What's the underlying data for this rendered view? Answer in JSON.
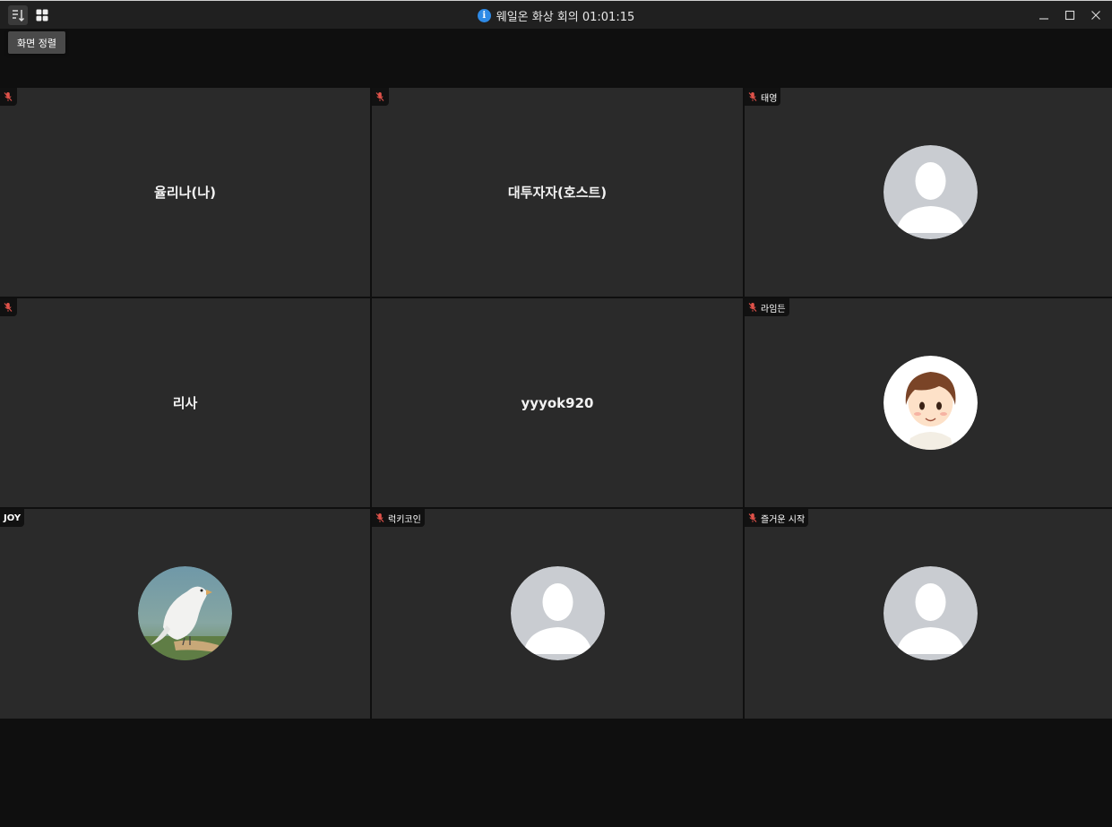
{
  "window": {
    "title": "웨일온 화상 회의 01:01:15",
    "toolbar": {
      "sort_icon": "sort-icon",
      "grid_icon": "grid-view-icon",
      "sort_tooltip": "화면 정렬"
    },
    "controls": [
      "minimize-icon",
      "maximize-icon",
      "close-icon"
    ]
  },
  "colors": {
    "background": "#0f0f0f",
    "tile": "#2a2a2a",
    "titlebar": "#202020",
    "muted_mic": "#e0524a",
    "info_badge": "#2e8ae6",
    "avatar_placeholder": "#c9ccd1"
  },
  "participants": [
    {
      "id": "p1",
      "tag": "",
      "muted": true,
      "display_name": "율리나(나)",
      "avatar": "none"
    },
    {
      "id": "p2",
      "tag": "",
      "muted": true,
      "display_name": "대투자자(호스트)",
      "avatar": "none"
    },
    {
      "id": "p3",
      "tag": "태영",
      "muted": true,
      "display_name": "",
      "avatar": "default-person-icon"
    },
    {
      "id": "p4",
      "tag": "",
      "muted": true,
      "display_name": "리사",
      "avatar": "none"
    },
    {
      "id": "p5",
      "tag": "",
      "muted": false,
      "display_name": "yyyok920",
      "avatar": "none"
    },
    {
      "id": "p6",
      "tag": "라임든",
      "muted": true,
      "display_name": "",
      "avatar": "cartoon-face-photo"
    },
    {
      "id": "p7",
      "tag": "JOY",
      "muted": false,
      "display_name": "",
      "avatar": "white-bird-photo"
    },
    {
      "id": "p8",
      "tag": "럭키코인",
      "muted": true,
      "display_name": "",
      "avatar": "default-person-icon"
    },
    {
      "id": "p9",
      "tag": "즐거운 시작",
      "muted": true,
      "display_name": "",
      "avatar": "default-person-icon"
    }
  ]
}
